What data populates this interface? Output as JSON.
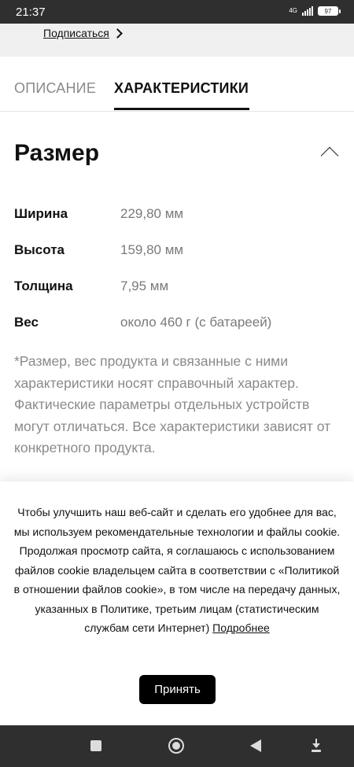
{
  "status_bar": {
    "time": "21:37",
    "network": "4G",
    "battery": "97",
    "signal_icon": "signal-bars-icon",
    "battery_icon": "battery-icon"
  },
  "header": {
    "subscribe_label": "Подписаться",
    "subscribe_icon": "chevron-right-icon"
  },
  "tabs": [
    {
      "label": "ОПИСАНИЕ",
      "active": false
    },
    {
      "label": "ХАРАКТЕРИСТИКИ",
      "active": true
    }
  ],
  "section": {
    "title": "Размер",
    "toggle_icon": "chevron-up-icon",
    "specs": [
      {
        "label": "Ширина",
        "value": "229,80 мм"
      },
      {
        "label": "Высота",
        "value": "159,80 мм"
      },
      {
        "label": "Толщина",
        "value": "7,95 мм"
      },
      {
        "label": "Вес",
        "value": "около 460 г (с батареей)"
      }
    ],
    "note": "*Размер, вес продукта и связанные с ними характеристики носят справочный характер. Фактические параметры отдельных устройств могут отличаться. Все характеристики зависят от конкретного продукта."
  },
  "cookie": {
    "text": "Чтобы улучшить наш веб-сайт и сделать его удобнее для вас, мы используем рекомендательные технологии и файлы cookie. Продолжая просмотр сайта, я соглашаюсь с использованием файлов cookie владельцем сайта в соответствии с «Политикой в отношении файлов cookie», в том числе на передачу данных, указанных в Политике, третьим лицам (статистическим службам сети Интернет)",
    "link_label": "Подробнее",
    "accept_label": "Принять"
  },
  "nav_bar": {
    "icons": [
      "square-recents-icon",
      "circle-home-icon",
      "triangle-back-icon",
      "download-icon"
    ]
  }
}
